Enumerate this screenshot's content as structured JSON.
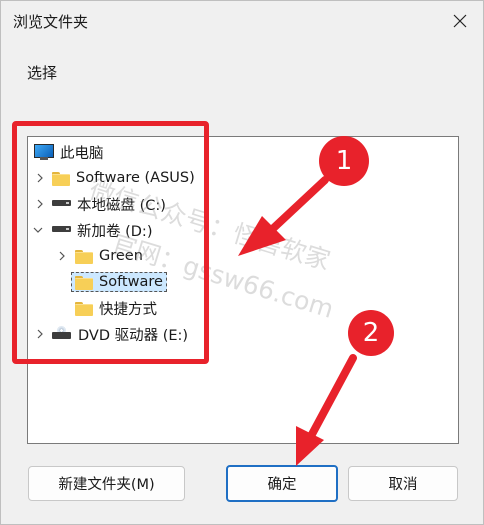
{
  "dialog": {
    "title": "浏览文件夹",
    "prompt": "选择"
  },
  "tree": {
    "items": [
      {
        "label": "此电脑",
        "icon": "computer-icon",
        "expanded": true
      },
      {
        "label": "Software (ASUS)",
        "icon": "folder-icon",
        "expanded": false
      },
      {
        "label": "本地磁盘 (C:)",
        "icon": "drive-icon",
        "expanded": false
      },
      {
        "label": "新加卷 (D:)",
        "icon": "drive-icon",
        "expanded": true
      },
      {
        "label": "Green",
        "icon": "folder-icon",
        "expanded": false
      },
      {
        "label": "Software",
        "icon": "folder-icon",
        "selected": true
      },
      {
        "label": "快捷方式",
        "icon": "folder-icon"
      },
      {
        "label": "DVD 驱动器 (E:)",
        "icon": "dvd-drive-icon",
        "expanded": false
      }
    ]
  },
  "buttons": {
    "new_folder": "新建文件夹(M)",
    "ok": "确定",
    "cancel": "取消"
  },
  "annotations": {
    "badge1": "1",
    "badge2": "2",
    "color": "#e8222b"
  },
  "watermark": {
    "line1": "微信公众号：怪兽软家",
    "line2": "官网：gssw66.com"
  }
}
